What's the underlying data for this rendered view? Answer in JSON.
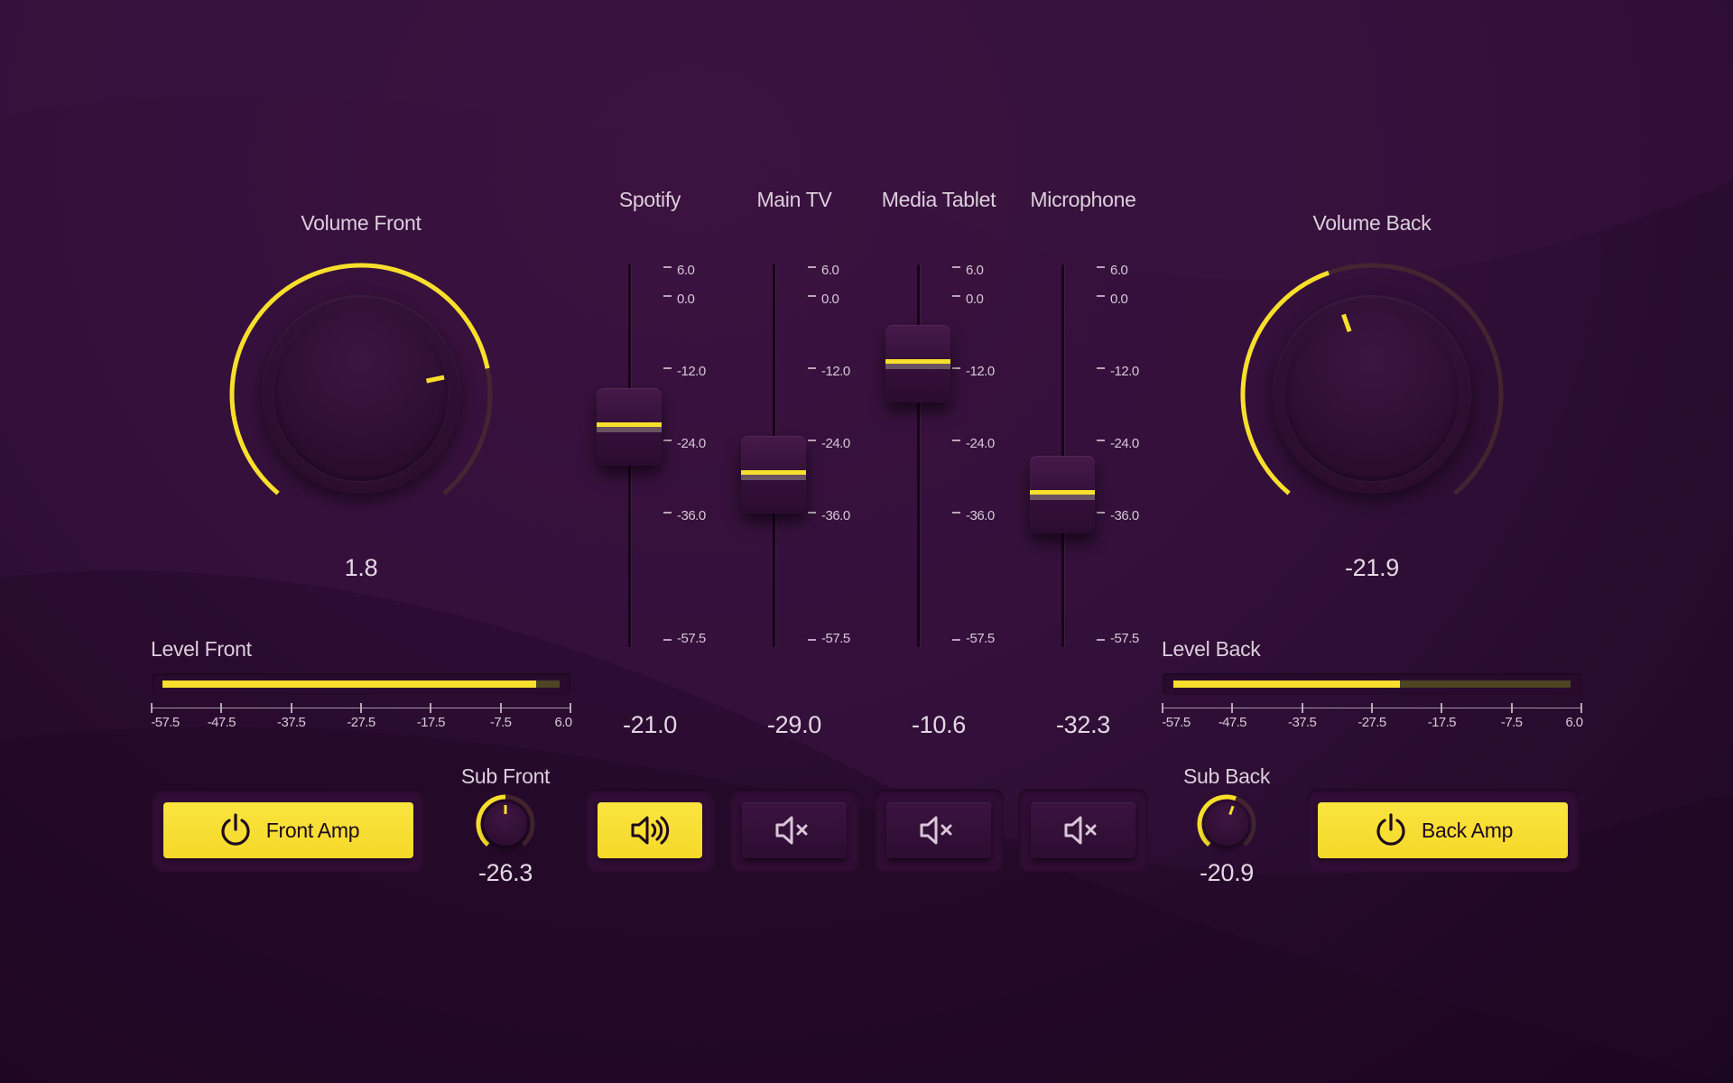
{
  "colors": {
    "accent": "#f8df2c",
    "background": "#33103a",
    "text": "#dccfdc"
  },
  "volume_front": {
    "label": "Volume Front",
    "value": "1.8",
    "level_fraction": 0.78
  },
  "volume_back": {
    "label": "Volume Back",
    "value": "-21.9",
    "level_fraction": 0.43
  },
  "fader_scale": [
    "6.0",
    "0.0",
    "-12.0",
    "-24.0",
    "-36.0",
    "-57.5"
  ],
  "faders": [
    {
      "label": "Spotify",
      "value": "-21.0",
      "muted": false,
      "icon": "speaker-on-icon"
    },
    {
      "label": "Main TV",
      "value": "-29.0",
      "muted": true,
      "icon": "speaker-muted-icon"
    },
    {
      "label": "Media Tablet",
      "value": "-10.6",
      "muted": true,
      "icon": "speaker-muted-icon"
    },
    {
      "label": "Microphone",
      "value": "-32.3",
      "muted": true,
      "icon": "speaker-muted-icon"
    }
  ],
  "level_scale": [
    "-57.5",
    "-47.5",
    "-37.5",
    "-27.5",
    "-17.5",
    "-7.5",
    "6.0"
  ],
  "level_front": {
    "label": "Level Front",
    "fill_fraction": 0.94
  },
  "level_back": {
    "label": "Level Back",
    "fill_fraction": 0.57
  },
  "front_amp": {
    "label": "Front Amp",
    "icon": "power-icon"
  },
  "back_amp": {
    "label": "Back Amp",
    "icon": "power-icon"
  },
  "sub_front": {
    "label": "Sub Front",
    "value": "-26.3",
    "level_fraction": 0.5
  },
  "sub_back": {
    "label": "Sub Back",
    "value": "-20.9",
    "level_fraction": 0.57
  }
}
